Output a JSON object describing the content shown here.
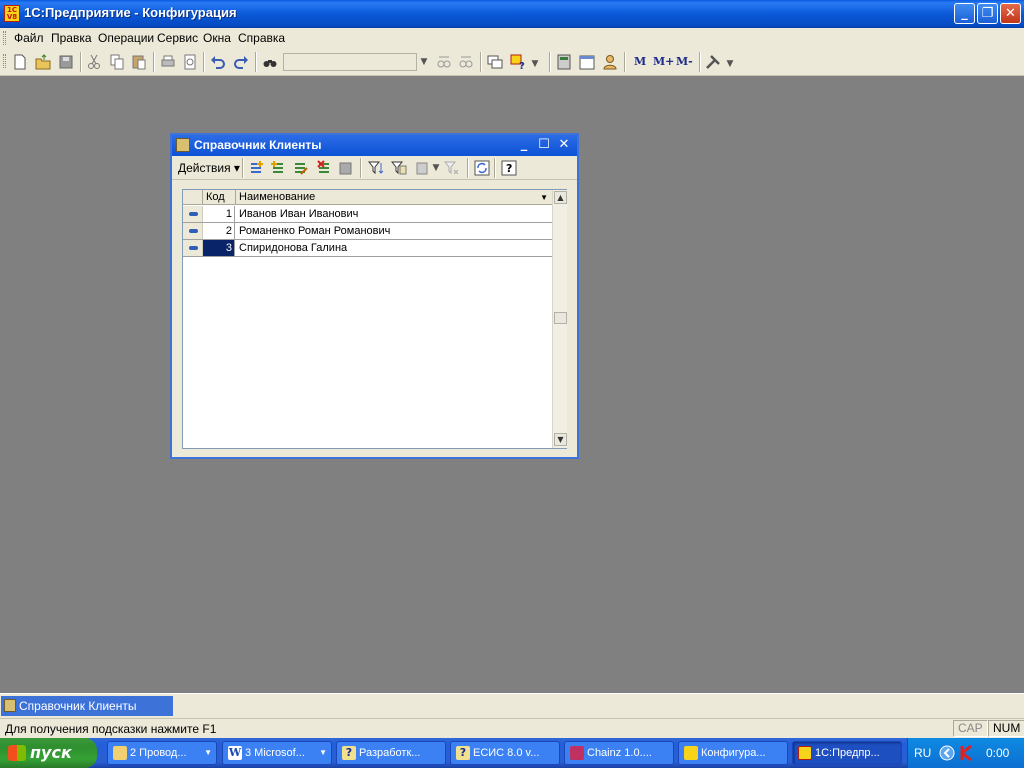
{
  "app": {
    "title": "1С:Предприятие - Конфигурация",
    "icon_text": "1C\nV8"
  },
  "menu": [
    {
      "label": "Файл"
    },
    {
      "label": "Правка"
    },
    {
      "label": "Операции"
    },
    {
      "label": "Сервис"
    },
    {
      "label": "Окна"
    },
    {
      "label": "Справка"
    }
  ],
  "toolbar": {
    "search_value": "",
    "m_buttons": [
      "M",
      "M+",
      "M-"
    ]
  },
  "child_window": {
    "title": "Справочник Клиенты",
    "actions_label": "Действия ▾",
    "columns": [
      "Код",
      "Наименование"
    ],
    "rows": [
      {
        "code": "1",
        "name": "Иванов Иван Иванович"
      },
      {
        "code": "2",
        "name": "Романенко Роман Романович"
      },
      {
        "code": "3",
        "name": "Спиридонова Галина"
      }
    ]
  },
  "window_bar": {
    "tab_label": "Справочник Клиенты"
  },
  "status": {
    "text": "Для получения подсказки нажмите F1",
    "cap": "CAP",
    "num": "NUM"
  },
  "taskbar": {
    "start_label": "пуск",
    "tasks": [
      {
        "label": "2 Провод..."
      },
      {
        "label": "3 Microsof..."
      },
      {
        "label": "Разработк..."
      },
      {
        "label": "ЕСИС 8.0 v..."
      },
      {
        "label": "Chainz 1.0...."
      },
      {
        "label": "Конфигура..."
      },
      {
        "label": "1С:Предпр..."
      }
    ],
    "lang": "RU",
    "clock": "0:00"
  },
  "colors": {
    "titlebar": "#0a58d8",
    "desktop": "#808080",
    "selection": "#0a246a",
    "taskbar": "#245edb",
    "start": "#2f8f2f"
  }
}
